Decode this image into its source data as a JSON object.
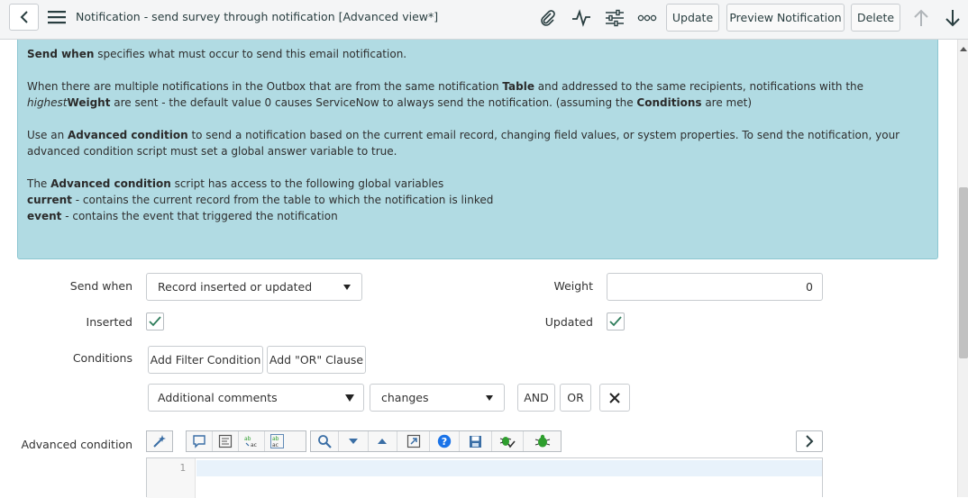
{
  "header": {
    "title": "Notification - send survey through notification",
    "view": "[Advanced view*]",
    "buttons": {
      "update": "Update",
      "preview": "Preview Notification",
      "delete": "Delete"
    },
    "icons": [
      "back-icon",
      "hamburger-icon",
      "paperclip-icon",
      "activity-icon",
      "settings-sliders-icon",
      "more-icon",
      "arrow-up-icon",
      "arrow-down-icon"
    ]
  },
  "info": {
    "p1": {
      "b1": "Send when",
      "t1": " specifies what must occur to send this email notification."
    },
    "p2": {
      "t1": "When there are multiple notifications in the Outbox that are from the same notification ",
      "b1": "Table",
      "t2": " and addressed to the same recipients, notifications with the ",
      "i1": "highest",
      "b2": "Weight",
      "t3": " are sent - the default value 0 causes ServiceNow to always send the notification. (assuming the ",
      "b3": "Conditions",
      "t4": " are met)"
    },
    "p3": {
      "t1": "Use an ",
      "b1": "Advanced condition",
      "t2": " to send a notification based on the current email record, changing field values, or system properties. To send the notification, your advanced condition script must set a global answer variable to true."
    },
    "p4": {
      "t1": "The ",
      "b1": "Advanced condition",
      "t2": " script has access to the following global variables",
      "b2": "current",
      "t3": " - contains the current record from the table to which the notification is linked",
      "b3": "event",
      "t4": " - contains the event that triggered the notification"
    }
  },
  "form": {
    "send_when": {
      "label": "Send when",
      "value": "Record inserted or updated"
    },
    "weight": {
      "label": "Weight",
      "value": "0"
    },
    "inserted": {
      "label": "Inserted",
      "checked": true
    },
    "updated": {
      "label": "Updated",
      "checked": true
    },
    "conditions": {
      "label": "Conditions",
      "add_filter": "Add Filter Condition",
      "add_or": "Add \"OR\" Clause",
      "field": "Additional comments",
      "operator": "changes",
      "and": "AND",
      "or": "OR"
    },
    "advanced_condition": {
      "label": "Advanced condition",
      "line_number": "1"
    }
  },
  "colors": {
    "info_bg": "#b1dbe3",
    "check": "#2e7d5b",
    "help_icon": "#1a73e8",
    "bug_icon": "#2e9e2e"
  }
}
